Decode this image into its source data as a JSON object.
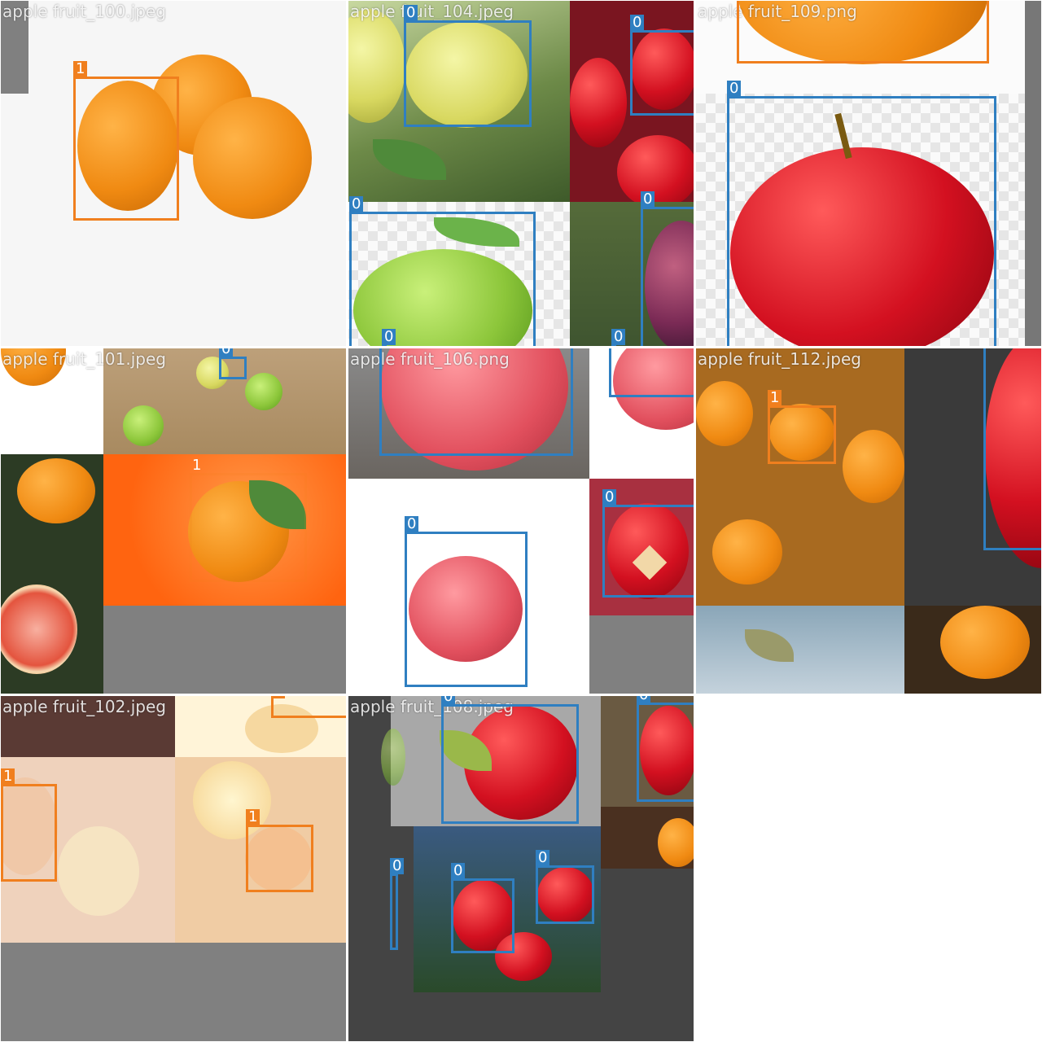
{
  "mosaic": {
    "classes": {
      "apple": "0",
      "orange": "1"
    },
    "colors": {
      "apple_box": "#2f7fc1",
      "orange_box": "#f07f1e",
      "filename_text": "#ffffff",
      "padding_gray": "#808080"
    },
    "cells": [
      {
        "filename": "apple fruit_100.jpeg",
        "boxes": [
          {
            "label": "1"
          }
        ]
      },
      {
        "filename": "apple fruit_104.jpeg",
        "boxes": [
          {
            "label": "0"
          },
          {
            "label": "0"
          },
          {
            "label": "0"
          },
          {
            "label": "0"
          },
          {
            "label": "0"
          },
          {
            "label": "0"
          }
        ]
      },
      {
        "filename": "apple fruit_109.png",
        "boxes": [
          {
            "label": "0"
          },
          {
            "label": "0"
          }
        ]
      },
      {
        "filename": "apple fruit_101.jpeg",
        "boxes": [
          {
            "label": "0"
          },
          {
            "label": "1"
          }
        ]
      },
      {
        "filename": "apple fruit_106.png",
        "boxes": [
          {
            "label": "0"
          },
          {
            "label": "0"
          }
        ]
      },
      {
        "filename": "apple fruit_112.jpeg",
        "boxes": [
          {
            "label": "1"
          },
          {
            "label": "0"
          }
        ]
      },
      {
        "filename": "apple fruit_102.jpeg",
        "boxes": [
          {
            "label": "1"
          },
          {
            "label": "1"
          },
          {
            "label": "1"
          }
        ]
      },
      {
        "filename": "apple fruit_108.jpeg",
        "boxes": [
          {
            "label": "0"
          },
          {
            "label": "0"
          },
          {
            "label": "0"
          },
          {
            "label": "0"
          },
          {
            "label": "0"
          }
        ]
      }
    ]
  }
}
